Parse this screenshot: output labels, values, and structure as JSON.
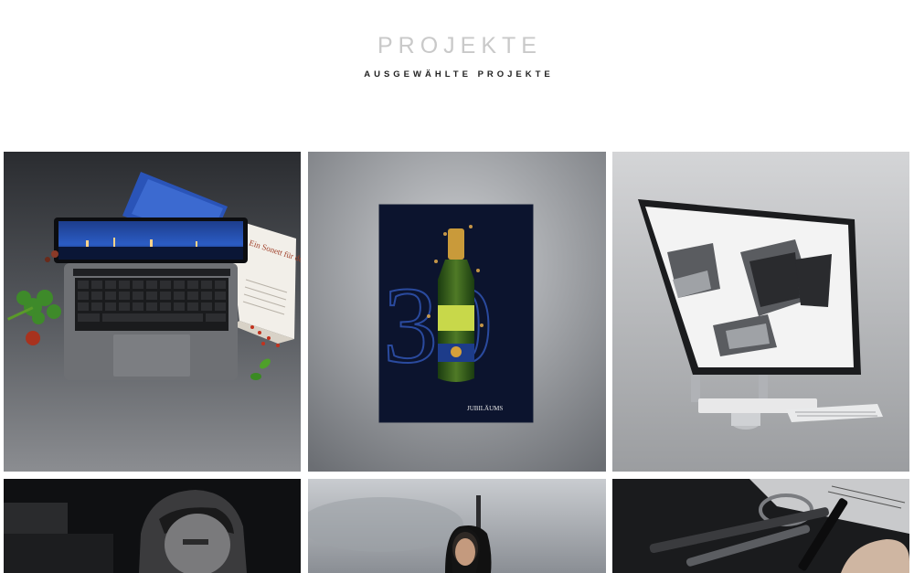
{
  "header": {
    "title": "PROJEKTE",
    "subtitle": "AUSGEWÄHLTE PROJEKTE"
  },
  "projects": [
    {
      "label": "Laptop & Magazin",
      "book_text": "Ein Sonett für den Gaumen",
      "icon": "laptop-mockup"
    },
    {
      "label": "Jubiläums-Poster",
      "poster_number": "30",
      "poster_caption": "JUBILÄUMS",
      "icon": "poster-mockup"
    },
    {
      "label": "Architektur Monitor",
      "icon": "monitor-mockup"
    },
    {
      "label": "Portrait Mann",
      "icon": "portrait"
    },
    {
      "label": "Portrait Frau",
      "icon": "portrait"
    },
    {
      "label": "Stift Detail",
      "icon": "pen-detail"
    }
  ],
  "colors": {
    "title": "#c9c9c9",
    "subtitle": "#222222",
    "accent_blue": "#1a3a8a"
  }
}
